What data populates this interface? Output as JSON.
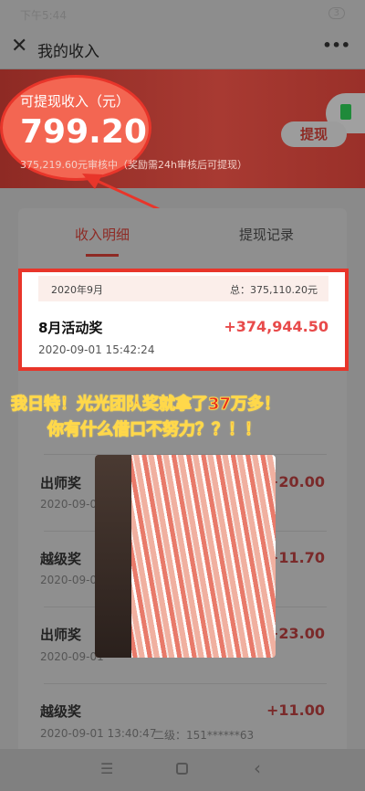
{
  "status": {
    "time": "下午5:44",
    "battery": "3"
  },
  "header": {
    "title": "我的收入",
    "more": "•••"
  },
  "banner": {
    "label": "可提现收入（元）",
    "amount": "799.20",
    "pending": "375,219.60元审核中（奖励需24h审核后可提现）",
    "withdraw": "提现"
  },
  "tabs": [
    {
      "label": "收入明细",
      "active": true
    },
    {
      "label": "提现记录",
      "active": false
    }
  ],
  "month": {
    "label": "2020年9月",
    "total": "总：375,110.20元"
  },
  "highlight": {
    "name": "8月活动奖",
    "amount": "+374,944.50",
    "date": "2020-09-01 15:42:24"
  },
  "caption": [
    "我日特！光光团队奖就拿了37万多！",
    "你有什么借口不努力？？！！"
  ],
  "rows": [
    {
      "name": "出师奖",
      "amount": "+20.00",
      "date": "2020-09-01"
    },
    {
      "name": "越级奖",
      "amount": "+11.70",
      "date": "2020-09-01"
    },
    {
      "name": "出师奖",
      "amount": "+23.00",
      "date": "2020-09-01"
    },
    {
      "name": "越级奖",
      "amount": "+11.00",
      "date": "2020-09-01 13:40:47",
      "extra": "二级：151******63"
    }
  ],
  "colors": {
    "accent": "#e8352a",
    "amount": "#e84a4a"
  }
}
